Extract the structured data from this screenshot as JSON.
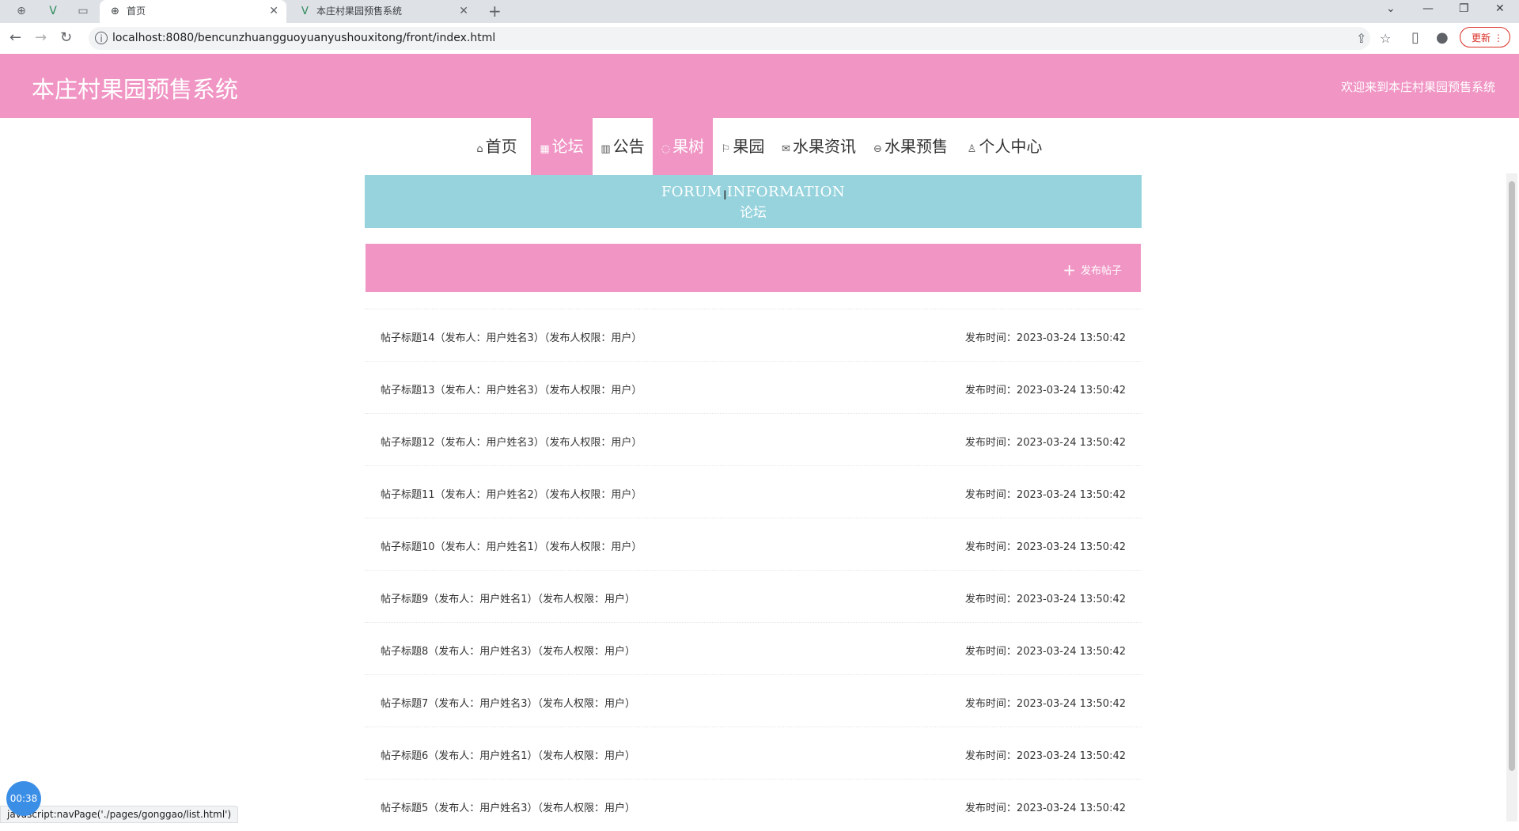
{
  "browser": {
    "tabs": [
      {
        "label": "首页",
        "active": true
      },
      {
        "label": "本庄村果园预售系统",
        "active": false
      }
    ],
    "url": "localhost:8080/bencunzhuangguoyuanyushouxitong/front/index.html",
    "update_label": "更新"
  },
  "header": {
    "title": "本庄村果园预售系统",
    "welcome": "欢迎来到本庄村果园预售系统"
  },
  "menu": [
    {
      "icon": "⌂",
      "label": "首页"
    },
    {
      "icon": "▦",
      "label": "论坛"
    },
    {
      "icon": "▥",
      "label": "公告"
    },
    {
      "icon": "◌",
      "label": "果树"
    },
    {
      "icon": "⚐",
      "label": "果园"
    },
    {
      "icon": "✉",
      "label": "水果资讯"
    },
    {
      "icon": "⊖",
      "label": "水果预售"
    },
    {
      "icon": "♙",
      "label": "个人中心"
    }
  ],
  "banner": {
    "en": "FORUM INFORMATION",
    "cn": "论坛"
  },
  "publish_label": "发布帖子",
  "posts": [
    {
      "title": "帖子标题14（发布人：用户姓名3）（发布人权限：用户）",
      "time": "发布时间：2023-03-24 13:50:42"
    },
    {
      "title": "帖子标题13（发布人：用户姓名3）（发布人权限：用户）",
      "time": "发布时间：2023-03-24 13:50:42"
    },
    {
      "title": "帖子标题12（发布人：用户姓名3）（发布人权限：用户）",
      "time": "发布时间：2023-03-24 13:50:42"
    },
    {
      "title": "帖子标题11（发布人：用户姓名2）（发布人权限：用户）",
      "time": "发布时间：2023-03-24 13:50:42"
    },
    {
      "title": "帖子标题10（发布人：用户姓名1）（发布人权限：用户）",
      "time": "发布时间：2023-03-24 13:50:42"
    },
    {
      "title": "帖子标题9（发布人：用户姓名1）（发布人权限：用户）",
      "time": "发布时间：2023-03-24 13:50:42"
    },
    {
      "title": "帖子标题8（发布人：用户姓名3）（发布人权限：用户）",
      "time": "发布时间：2023-03-24 13:50:42"
    },
    {
      "title": "帖子标题7（发布人：用户姓名3）（发布人权限：用户）",
      "time": "发布时间：2023-03-24 13:50:42"
    },
    {
      "title": "帖子标题6（发布人：用户姓名1）（发布人权限：用户）",
      "time": "发布时间：2023-03-24 13:50:42"
    },
    {
      "title": "帖子标题5（发布人：用户姓名3）（发布人权限：用户）",
      "time": "发布时间：2023-03-24 13:50:42"
    }
  ],
  "status_text": "javascript:navPage('./pages/gonggao/list.html')",
  "timer": "00:38",
  "colors": {
    "accent": "#f095c4",
    "banner": "#96d3dd"
  }
}
